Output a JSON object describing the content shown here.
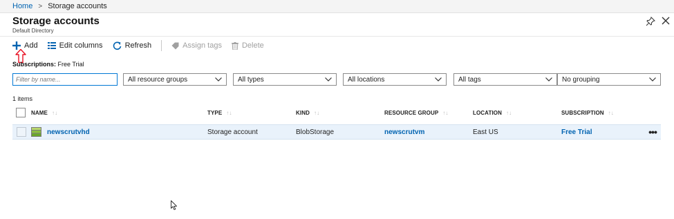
{
  "breadcrumb": {
    "home": "Home",
    "separator": ">",
    "current": "Storage accounts"
  },
  "header": {
    "title": "Storage accounts",
    "subtitle": "Default Directory"
  },
  "toolbar": {
    "add": "Add",
    "edit_columns": "Edit columns",
    "refresh": "Refresh",
    "assign_tags": "Assign tags",
    "delete": "Delete"
  },
  "subscriptions": {
    "label": "Subscriptions:",
    "value": "Free Trial"
  },
  "filters": {
    "name_placeholder": "Filter by name...",
    "resource_groups": "All resource groups",
    "types": "All types",
    "locations": "All locations",
    "tags": "All tags",
    "grouping": "No grouping"
  },
  "list": {
    "count": "1 items",
    "columns": [
      "NAME",
      "TYPE",
      "KIND",
      "RESOURCE GROUP",
      "LOCATION",
      "SUBSCRIPTION"
    ],
    "rows": [
      {
        "name": "newscrutvhd",
        "type": "Storage account",
        "kind": "BlobStorage",
        "resource_group": "newscrutvm",
        "location": "East US",
        "subscription": "Free Trial"
      }
    ],
    "more_glyph": "•••"
  },
  "icons": {
    "add": "plus-icon",
    "edit_columns": "columns-icon",
    "refresh": "refresh-icon",
    "assign_tags": "tag-icon",
    "delete": "trash-icon",
    "pin": "pin-icon",
    "close": "close-icon",
    "storage": "storage-account-icon",
    "annotation": "red-arrow-icon"
  },
  "colors": {
    "accent": "#0078d4",
    "link": "#0063b1",
    "row_selected": "#e9f2fb",
    "annotation": "#e81123"
  }
}
